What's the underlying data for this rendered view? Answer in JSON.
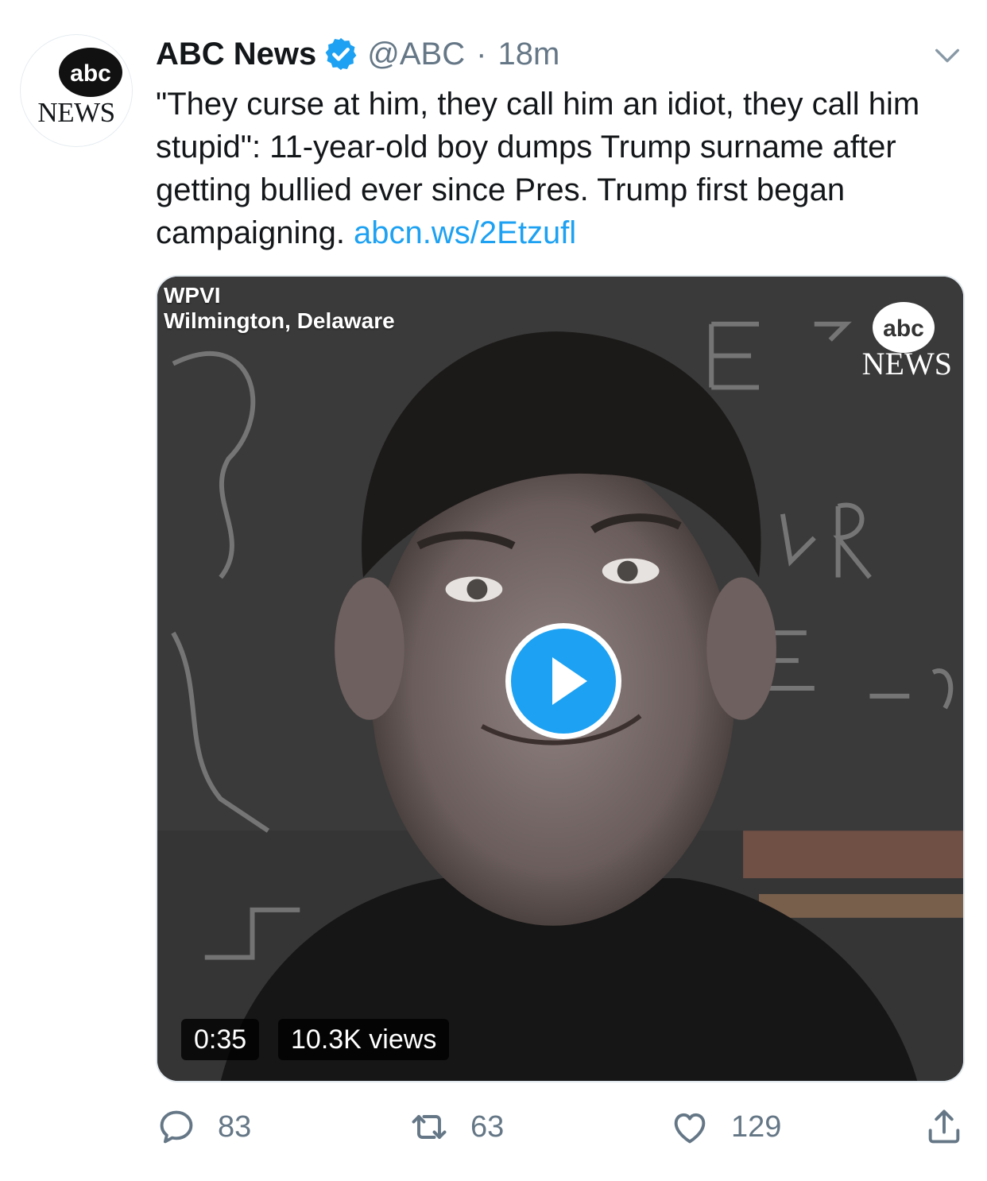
{
  "author": {
    "avatar_logo_text": "abc",
    "avatar_news_text": "NEWS",
    "name": "ABC News",
    "handle": "@ABC",
    "separator": "·",
    "time": "18m",
    "verified": true
  },
  "tweet": {
    "text": "\"They curse at him, they call him an idiot, they call him stupid\": 11-year-old boy dumps Trump surname after getting bullied ever since Pres. Trump first began campaigning. ",
    "link": "abcn.ws/2Etzufl"
  },
  "media": {
    "type": "video",
    "overlay_station": "WPVI",
    "overlay_location": "Wilmington, Delaware",
    "watermark_logo_text": "abc",
    "watermark_news_text": "NEWS",
    "duration": "0:35",
    "views": "10.3K views"
  },
  "actions": {
    "reply_count": "83",
    "retweet_count": "63",
    "like_count": "129"
  },
  "icons": [
    "verified-badge-icon",
    "chevron-down-icon",
    "play-icon",
    "reply-icon",
    "retweet-icon",
    "like-icon",
    "share-icon"
  ],
  "colors": {
    "accent": "#1da1f2",
    "text": "#14171a",
    "secondary": "#657786"
  }
}
